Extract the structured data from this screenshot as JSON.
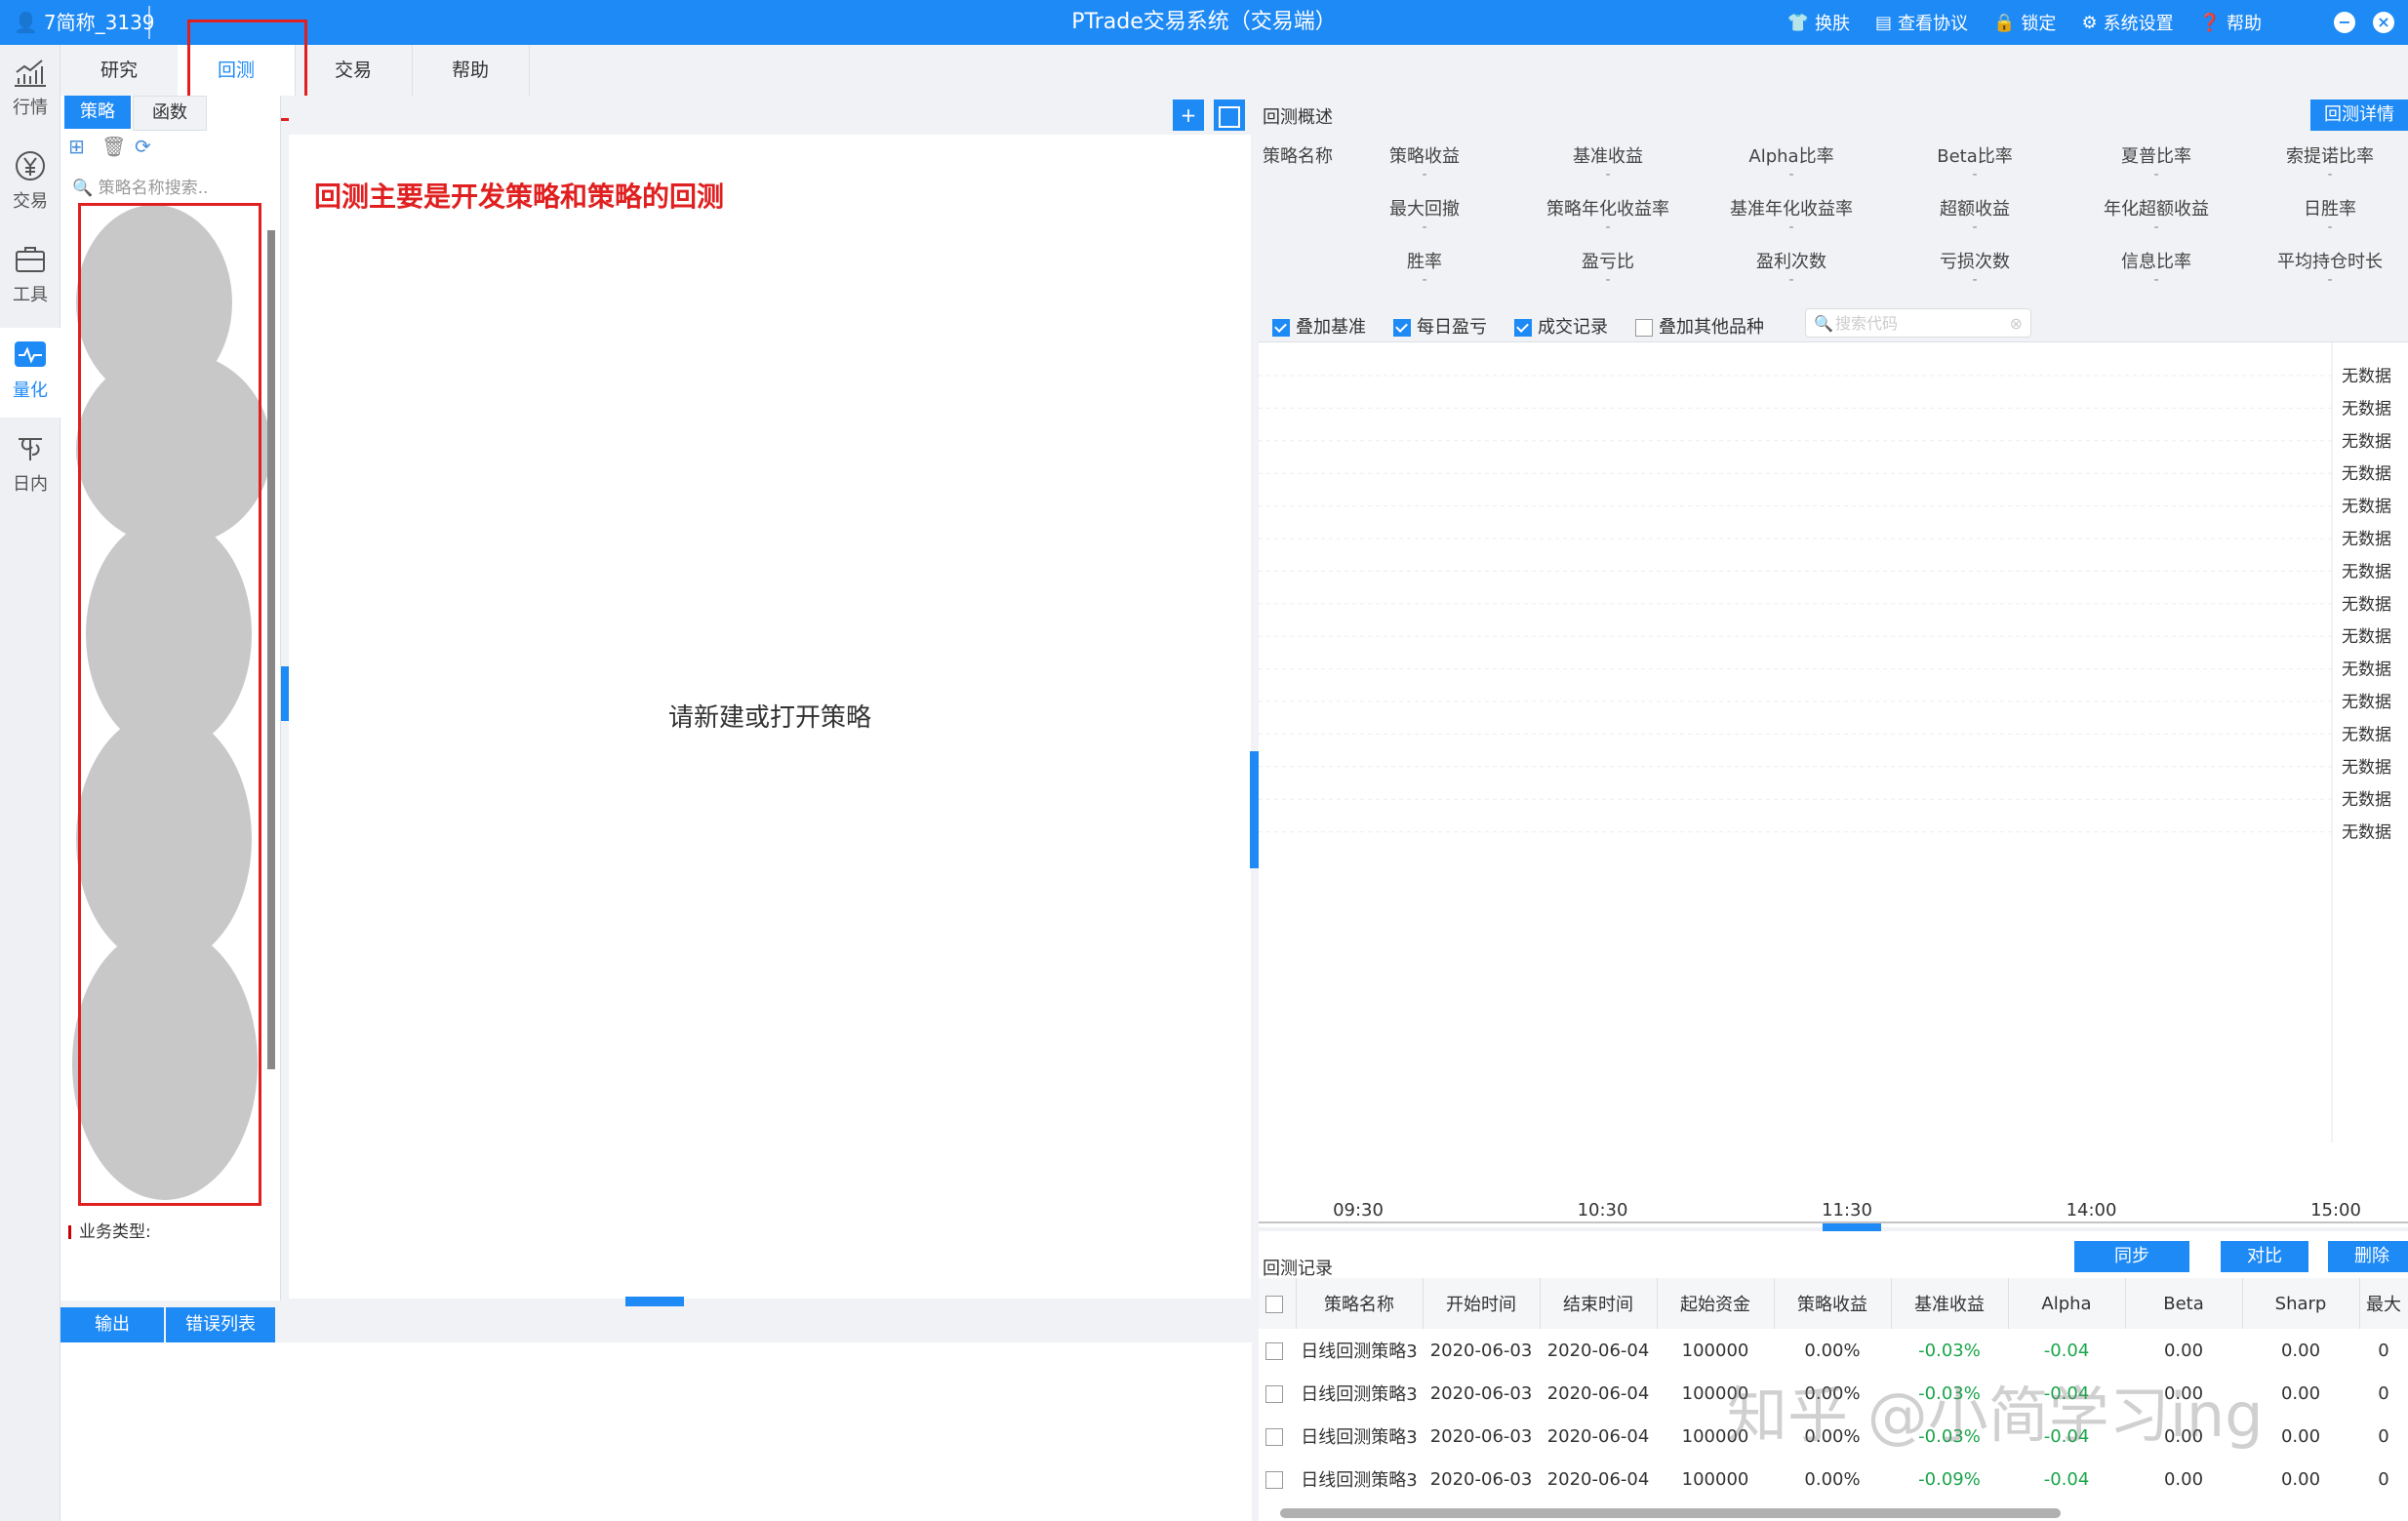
{
  "titlebar": {
    "user": "7简称_3139",
    "title": "PTrade交易系统（交易端）",
    "actions": [
      {
        "label": "换肤",
        "icon": "shirt-icon"
      },
      {
        "label": "查看协议",
        "icon": "document-icon"
      },
      {
        "label": "锁定",
        "icon": "lock-icon"
      },
      {
        "label": "系统设置",
        "icon": "gear-icon"
      },
      {
        "label": "帮助",
        "icon": "help-icon"
      }
    ]
  },
  "sidebar": {
    "items": [
      {
        "label": "行情",
        "icon": "bar-chart-icon"
      },
      {
        "label": "交易",
        "icon": "yen-icon"
      },
      {
        "label": "工具",
        "icon": "toolbox-icon"
      },
      {
        "label": "量化",
        "icon": "quant-icon",
        "active": true
      },
      {
        "label": "日内",
        "icon": "intraday-icon"
      }
    ]
  },
  "menu": {
    "tabs": [
      "研究",
      "回测",
      "交易",
      "帮助"
    ],
    "active": "回测"
  },
  "leftpanel": {
    "tabs": [
      "策略",
      "函数"
    ],
    "search_placeholder": "策略名称搜索..",
    "biz_type": "业务类型:"
  },
  "editor": {
    "annotation": "回测主要是开发策略和策略的回测",
    "empty_message": "请新建或打开策略",
    "add_label": "+"
  },
  "output": {
    "tabs": [
      "输出",
      "错误列表"
    ]
  },
  "overview": {
    "caption": "回测概述",
    "detail_button": "回测详情",
    "row1": [
      "策略名称",
      "策略收益",
      "基准收益",
      "Alpha比率",
      "Beta比率",
      "夏普比率",
      "索提诺比率"
    ],
    "row2": [
      "最大回撤",
      "策略年化收益率",
      "基准年化收益率",
      "超额收益",
      "年化超额收益",
      "日胜率"
    ],
    "row3": [
      "胜率",
      "盈亏比",
      "盈利次数",
      "亏损次数",
      "信息比率",
      "平均持仓时长"
    ],
    "placeholder": "-",
    "options": [
      {
        "label": "叠加基准",
        "checked": true
      },
      {
        "label": "每日盈亏",
        "checked": true
      },
      {
        "label": "成交记录",
        "checked": true
      },
      {
        "label": "叠加其他品种",
        "checked": false
      }
    ],
    "search_placeholder": "搜索代码"
  },
  "chart_data": {
    "type": "line",
    "x": [
      "09:30",
      "10:30",
      "11:30",
      "14:00",
      "15:00"
    ],
    "y_tick_labels": [
      "无数据",
      "无数据",
      "无数据",
      "无数据",
      "无数据",
      "无数据",
      "无数据",
      "无数据",
      "无数据",
      "无数据",
      "无数据",
      "无数据",
      "无数据",
      "无数据",
      "无数据"
    ],
    "series": [],
    "grid": true
  },
  "records": {
    "caption": "回测记录",
    "buttons": [
      "同步",
      "对比",
      "删除"
    ],
    "columns": [
      "策略名称",
      "开始时间",
      "结束时间",
      "起始资金",
      "策略收益",
      "基准收益",
      "Alpha",
      "Beta",
      "Sharp",
      "最大"
    ],
    "rows": [
      [
        "日线回测策略3",
        "2020-06-03",
        "2020-06-04",
        "100000",
        "0.00%",
        "-0.03%",
        "-0.04",
        "0.00",
        "0.00",
        "0"
      ],
      [
        "日线回测策略3",
        "2020-06-03",
        "2020-06-04",
        "100000",
        "0.00%",
        "-0.03%",
        "-0.04",
        "0.00",
        "0.00",
        "0"
      ],
      [
        "日线回测策略3",
        "2020-06-03",
        "2020-06-04",
        "100000",
        "0.00%",
        "-0.03%",
        "-0.04",
        "0.00",
        "0.00",
        "0"
      ],
      [
        "日线回测策略3",
        "2020-06-03",
        "2020-06-04",
        "100000",
        "0.00%",
        "-0.09%",
        "-0.04",
        "0.00",
        "0.00",
        "0"
      ]
    ]
  },
  "watermark": "知乎 @小简学习ing",
  "colors": {
    "accent": "#1e8af5",
    "annotation": "#e02020",
    "negative_green": "#1aa54a"
  }
}
